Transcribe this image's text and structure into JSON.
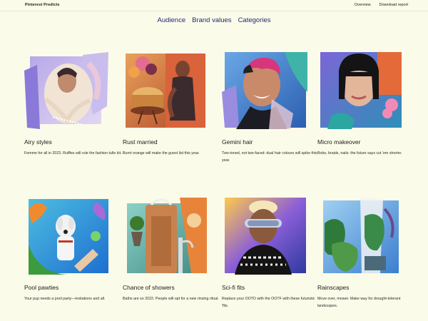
{
  "header": {
    "brand": "Pinterest Predicts",
    "links": [
      "Overview",
      "Download report"
    ]
  },
  "subnav": [
    "Audience",
    "Brand values",
    "Categories"
  ],
  "cards": [
    {
      "title": "Airy styles",
      "desc": "Femme for all in 2023. Ruffles will rule the fashion tulle kit."
    },
    {
      "title": "Rust married",
      "desc": "Burnt orange will make the guest list this year."
    },
    {
      "title": "Gemini hair",
      "desc": "Two-toned, not two-faced: dual hair colours will spike this year."
    },
    {
      "title": "Micro makeover",
      "desc": "Bobs, braids, nails: the future says cut 'em shorter."
    },
    {
      "title": "Pool pawties",
      "desc": "Your pup needs a pool party—invitations and all."
    },
    {
      "title": "Chance of showers",
      "desc": "Baths are so 2022. People will opt for a new rinsing ritual."
    },
    {
      "title": "Sci-fi fits",
      "desc": "Replace your OOTD with the OOTF with these futuristic 'fits."
    },
    {
      "title": "Rainscapes",
      "desc": "Move over, mower. Make way for drought-tolerant landscapes."
    }
  ]
}
